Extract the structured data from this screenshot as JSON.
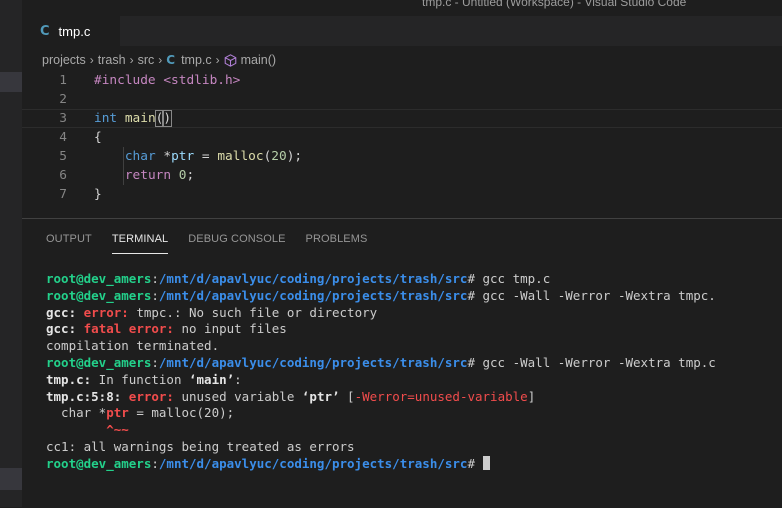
{
  "window": {
    "title": "tmp.c - Untitled (Workspace) - Visual Studio Code"
  },
  "tabs": [
    {
      "icon": "c-file-icon",
      "icon_glyph": "C",
      "label": "tmp.c"
    }
  ],
  "breadcrumb": {
    "items": [
      "projects",
      "trash",
      "src"
    ],
    "file_icon_glyph": "C",
    "file": "tmp.c",
    "symbol_icon": "cube-icon",
    "symbol": "main()"
  },
  "editor": {
    "line_numbers": [
      "1",
      "2",
      "3",
      "4",
      "5",
      "6",
      "7"
    ],
    "lines": [
      {
        "segments": [
          {
            "t": "#include ",
            "c": "kw-pp"
          },
          {
            "t": "<stdlib.h>",
            "c": "kw-pp"
          }
        ]
      },
      {
        "segments": []
      },
      {
        "segments": [
          {
            "t": "int",
            "c": "kw"
          },
          {
            "t": " ",
            "c": "txt"
          },
          {
            "t": "main",
            "c": "fn"
          },
          {
            "t": "(",
            "c": "txt brace-match"
          },
          {
            "t": ")",
            "c": "txt brace-match"
          }
        ]
      },
      {
        "segments": [
          {
            "t": "{",
            "c": "txt"
          }
        ]
      },
      {
        "segments": [
          {
            "t": "    ",
            "c": "txt"
          },
          {
            "t": "char",
            "c": "kw"
          },
          {
            "t": " *",
            "c": "txt"
          },
          {
            "t": "ptr",
            "c": "var"
          },
          {
            "t": " = ",
            "c": "txt"
          },
          {
            "t": "malloc",
            "c": "fn"
          },
          {
            "t": "(",
            "c": "txt"
          },
          {
            "t": "20",
            "c": "num"
          },
          {
            "t": ");",
            "c": "txt"
          }
        ]
      },
      {
        "segments": [
          {
            "t": "    ",
            "c": "txt"
          },
          {
            "t": "return",
            "c": "kw-ctrl"
          },
          {
            "t": " ",
            "c": "txt"
          },
          {
            "t": "0",
            "c": "num"
          },
          {
            "t": ";",
            "c": "txt"
          }
        ]
      },
      {
        "segments": [
          {
            "t": "}",
            "c": "txt"
          }
        ]
      }
    ]
  },
  "panel": {
    "tabs": [
      "OUTPUT",
      "TERMINAL",
      "DEBUG CONSOLE",
      "PROBLEMS"
    ],
    "active_tab": "TERMINAL"
  },
  "terminal": {
    "lines": [
      [
        {
          "t": "root@dev_amers",
          "c": "t-user"
        },
        {
          "t": ":",
          "c": ""
        },
        {
          "t": "/mnt/d/apavlyuc/coding/projects/trash/src",
          "c": "t-path"
        },
        {
          "t": "# gcc tmp.c",
          "c": ""
        }
      ],
      [
        {
          "t": "root@dev_amers",
          "c": "t-user"
        },
        {
          "t": ":",
          "c": ""
        },
        {
          "t": "/mnt/d/apavlyuc/coding/projects/trash/src",
          "c": "t-path"
        },
        {
          "t": "# gcc -Wall -Werror -Wextra tmpc.",
          "c": ""
        }
      ],
      [
        {
          "t": "gcc:",
          "c": "t-bold"
        },
        {
          "t": " ",
          "c": ""
        },
        {
          "t": "error:",
          "c": "t-err"
        },
        {
          "t": " tmpc.: No such file or directory",
          "c": ""
        }
      ],
      [
        {
          "t": "gcc:",
          "c": "t-bold"
        },
        {
          "t": " ",
          "c": ""
        },
        {
          "t": "fatal error:",
          "c": "t-err"
        },
        {
          "t": " no input files",
          "c": ""
        }
      ],
      [
        {
          "t": "compilation terminated.",
          "c": ""
        }
      ],
      [
        {
          "t": "root@dev_amers",
          "c": "t-user"
        },
        {
          "t": ":",
          "c": ""
        },
        {
          "t": "/mnt/d/apavlyuc/coding/projects/trash/src",
          "c": "t-path"
        },
        {
          "t": "# gcc -Wall -Werror -Wextra tmp.c",
          "c": ""
        }
      ],
      [
        {
          "t": "tmp.c:",
          "c": "t-bold"
        },
        {
          "t": " In function ",
          "c": ""
        },
        {
          "t": "‘main’",
          "c": "t-bold"
        },
        {
          "t": ":",
          "c": ""
        }
      ],
      [
        {
          "t": "tmp.c:5:8:",
          "c": "t-bold"
        },
        {
          "t": " ",
          "c": ""
        },
        {
          "t": "error:",
          "c": "t-err"
        },
        {
          "t": " unused variable ",
          "c": ""
        },
        {
          "t": "‘ptr’",
          "c": "t-bold"
        },
        {
          "t": " [",
          "c": ""
        },
        {
          "t": "-Werror=unused-variable",
          "c": "t-red"
        },
        {
          "t": "]",
          "c": ""
        }
      ],
      [
        {
          "t": "  char *",
          "c": ""
        },
        {
          "t": "ptr",
          "c": "t-err"
        },
        {
          "t": " = malloc(20);",
          "c": ""
        }
      ],
      [
        {
          "t": "        ",
          "c": ""
        },
        {
          "t": "^~~",
          "c": "t-err"
        }
      ],
      [
        {
          "t": "cc1: all warnings being treated as errors",
          "c": ""
        }
      ],
      [
        {
          "t": "root@dev_amers",
          "c": "t-user"
        },
        {
          "t": ":",
          "c": ""
        },
        {
          "t": "/mnt/d/apavlyuc/coding/projects/trash/src",
          "c": "t-path"
        },
        {
          "t": "# ",
          "c": ""
        }
      ]
    ]
  }
}
